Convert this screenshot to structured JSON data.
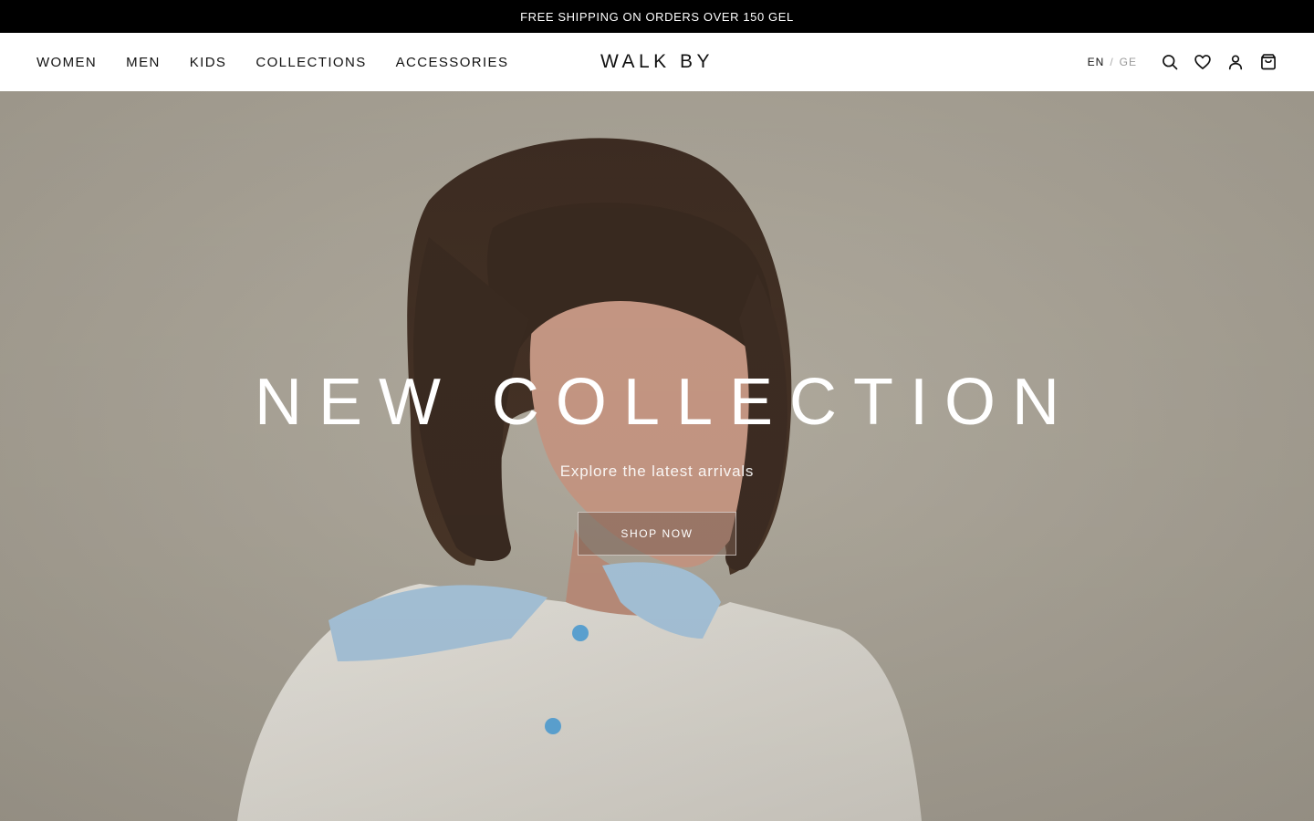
{
  "announcement": {
    "text": "FREE SHIPPING ON ORDERS OVER 150 GEL"
  },
  "header": {
    "nav": [
      {
        "label": "WOMEN"
      },
      {
        "label": "MEN"
      },
      {
        "label": "KIDS"
      },
      {
        "label": "COLLECTIONS"
      },
      {
        "label": "ACCESSORIES"
      }
    ],
    "logo": "WALK BY",
    "language": {
      "active": "EN",
      "separator": "/",
      "inactive": "GE"
    },
    "icons": [
      "search-icon",
      "heart-icon",
      "account-icon",
      "bag-icon"
    ]
  },
  "hero": {
    "title": "NEW COLLECTION",
    "subtitle": "Explore the latest arrivals",
    "button_label": "SHOP NOW"
  },
  "colors": {
    "announcement_bg": "#000000",
    "hero_bg": "#aba597",
    "button_bg": "#7a5c50"
  }
}
